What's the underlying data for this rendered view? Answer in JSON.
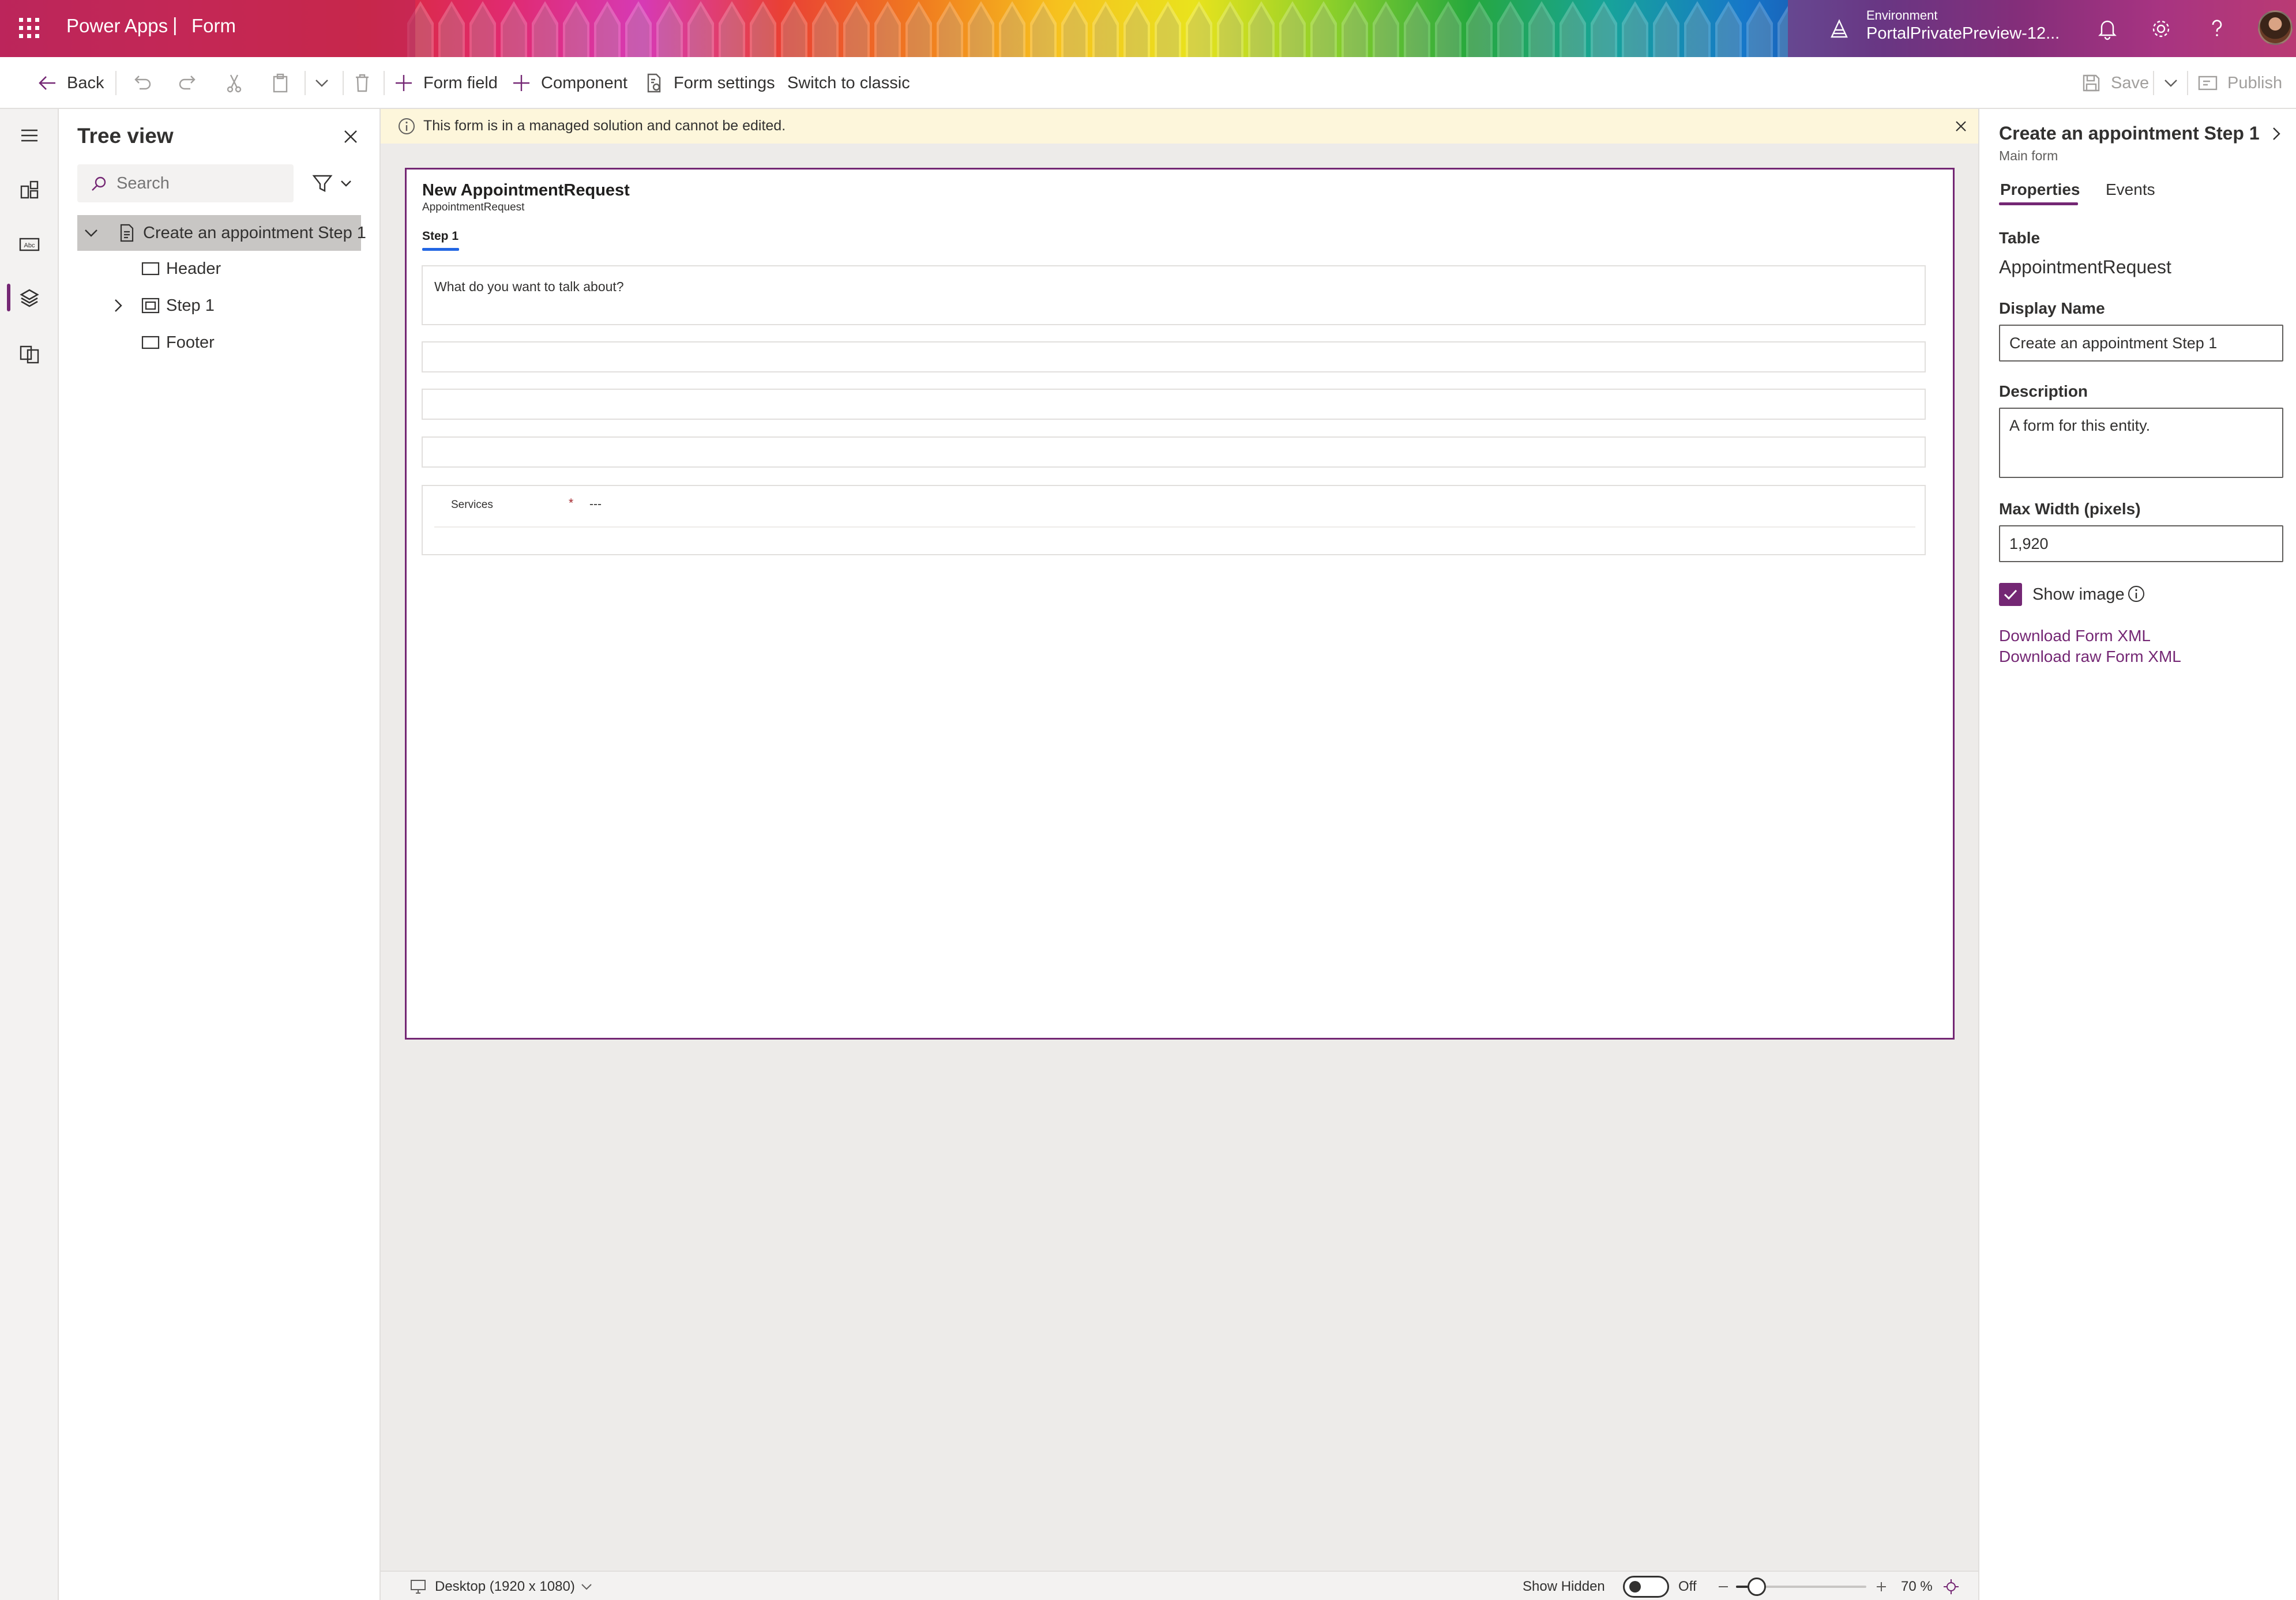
{
  "appbar": {
    "app_name": "Power Apps",
    "separator": "|",
    "page_name": "Form",
    "environment_label": "Environment",
    "environment_name": "PortalPrivatePreview-12...",
    "brand_color": "#742774"
  },
  "commandbar": {
    "back": "Back",
    "form_field": "Form field",
    "component": "Component",
    "form_settings": "Form settings",
    "switch_classic": "Switch to classic",
    "save": "Save",
    "publish": "Publish"
  },
  "tree": {
    "title": "Tree view",
    "search_placeholder": "Search",
    "root": "Create an appointment Step 1",
    "children": [
      "Header",
      "Step 1",
      "Footer"
    ]
  },
  "banner": {
    "message": "This form is in a managed solution and cannot be edited."
  },
  "form": {
    "title": "New AppointmentRequest",
    "subtitle": "AppointmentRequest",
    "tab": "Step 1",
    "question": "What do you want to talk about?",
    "services_label": "Services",
    "services_required": "*",
    "services_value": "---"
  },
  "statusbar": {
    "device": "Desktop (1920 x 1080)",
    "show_hidden": "Show Hidden",
    "toggle_state": "Off",
    "zoom": "70 %",
    "zoom_percent": 70
  },
  "props": {
    "title": "Create an appointment Step 1",
    "subtitle": "Main form",
    "tabs": [
      "Properties",
      "Events"
    ],
    "table_label": "Table",
    "table_value": "AppointmentRequest",
    "display_name_label": "Display Name",
    "display_name_value": "Create an appointment Step 1",
    "description_label": "Description",
    "description_value": "A form for this entity.",
    "max_width_label": "Max Width (pixels)",
    "max_width_value": "1,920",
    "show_image_label": "Show image",
    "show_image_checked": true,
    "link_download_xml": "Download Form XML",
    "link_download_raw": "Download raw Form XML"
  }
}
